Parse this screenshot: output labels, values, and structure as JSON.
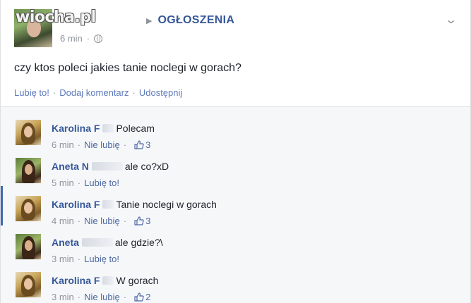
{
  "post": {
    "watermark": "wiocha.pl",
    "group_name": "OGŁOSZENIA",
    "time": "6 min",
    "text": "czy ktos poleci jakies tanie noclegi w gorach?",
    "actions": [
      "Lubię to!",
      "Dodaj komentarz",
      "Udostępnij"
    ]
  },
  "comments": [
    {
      "author": "Karolina F",
      "text": "Polecam",
      "time": "6 min",
      "like_label": "Nie lubię",
      "likes": "3",
      "highlight": false
    },
    {
      "author": "Aneta N",
      "text": "ale co?xD",
      "time": "5 min",
      "like_label": "Lubię to!",
      "likes": "",
      "highlight": false
    },
    {
      "author": "Karolina F",
      "text": "Tanie noclegi w gorach",
      "time": "4 min",
      "like_label": "Nie lubię",
      "likes": "3",
      "highlight": true
    },
    {
      "author": "Aneta",
      "text": "ale gdzie?\\",
      "time": "3 min",
      "like_label": "Lubię to!",
      "likes": "",
      "highlight": false
    },
    {
      "author": "Karolina F",
      "text": "W gorach",
      "time": "3 min",
      "like_label": "Nie lubię",
      "likes": "2",
      "highlight": false
    }
  ],
  "colors": {
    "link": "#365899",
    "meta": "#90949c",
    "comment_bg": "#f6f7f9",
    "accent": "#4267b2"
  }
}
